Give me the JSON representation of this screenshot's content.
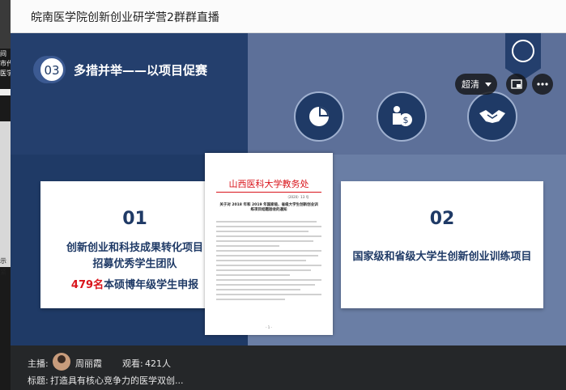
{
  "window": {
    "title": "皖南医学院创新创业研学营2群群直播"
  },
  "left_strip": {
    "fragments": [
      "间",
      "市代7",
      "医学院",
      "示",
      "紧"
    ]
  },
  "player": {
    "quality_label": "超清",
    "brand_color": "#1f3a66",
    "accent_red": "#d9141b"
  },
  "slide": {
    "section_number": "03",
    "heading": "多措并举——以项目促赛",
    "icons": [
      "pie-chart-icon",
      "money-person-icon",
      "handshake-icon"
    ],
    "card_left": {
      "number": "01",
      "line1": "创新创业和科技成果转化项目",
      "line2": "招募优秀学生团队",
      "highlight": "479名",
      "line3_rest": "本硕博年级学生申报"
    },
    "card_right": {
      "number": "02",
      "line1": "国家级和省级大学生创新创业训练项目"
    },
    "document": {
      "issuer": "山西医科大学教务处",
      "doc_number": "（2020）13 号",
      "title": "关于对 2018 年和 2019 年国家级、省级大学生创新创业训练项目结题验收的通知",
      "page": "- 1 -"
    }
  },
  "footer": {
    "host_label": "主播:",
    "host_name": "周丽霞",
    "viewers_label": "观看:",
    "viewers_value": "421人",
    "subject_label": "标题:",
    "subject_value": "打造具有核心竞争力的医学双创..."
  }
}
